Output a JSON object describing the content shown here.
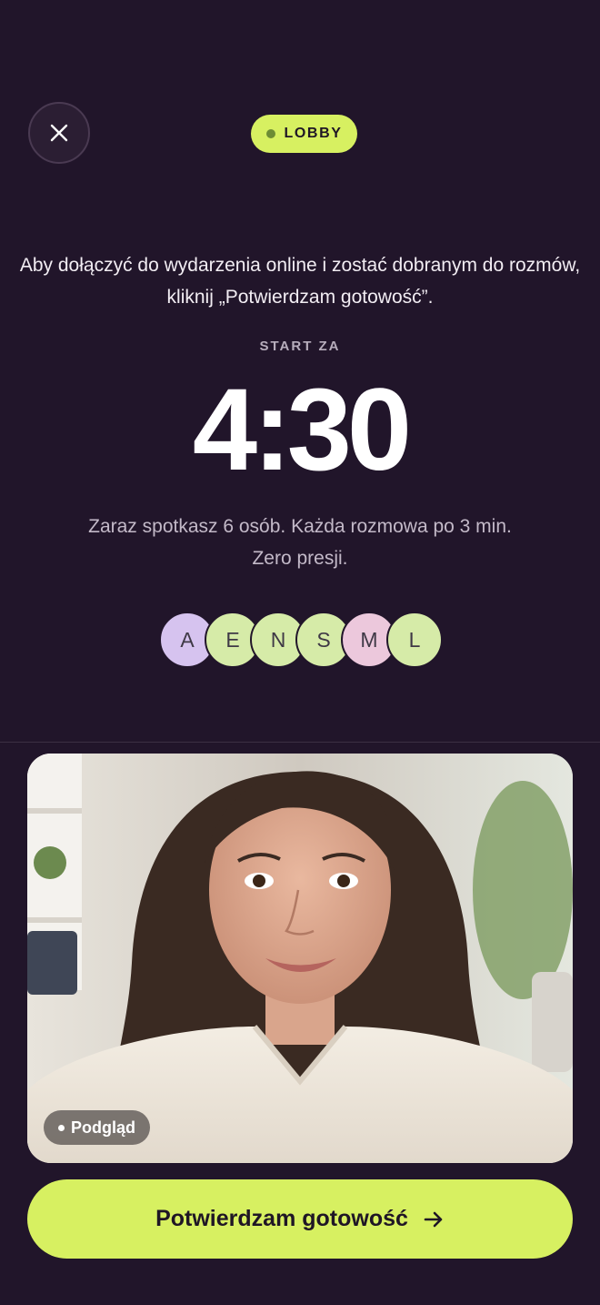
{
  "header": {
    "close_icon": "close-icon",
    "badge_label": "LOBBY",
    "badge_dot_color": "#6d8c34"
  },
  "intro": {
    "text": "Aby dołączyć do wydarzenia online i zostać dobranym do rozmów, kliknij „Potwierdzam gotowość”."
  },
  "countdown": {
    "label": "START ZA",
    "time": "4:30"
  },
  "description": {
    "text": "Zaraz spotkasz 6 osób. Każda rozmowa po 3 min. Zero presji."
  },
  "participants": [
    {
      "initial": "A",
      "color": "#d6c3ef"
    },
    {
      "initial": "E",
      "color": "#d6eba8"
    },
    {
      "initial": "N",
      "color": "#d6eba8"
    },
    {
      "initial": "S",
      "color": "#d6eba8"
    },
    {
      "initial": "M",
      "color": "#ecc8dc"
    },
    {
      "initial": "L",
      "color": "#d6eba8"
    }
  ],
  "preview": {
    "badge_label": "Podgląd"
  },
  "cta": {
    "label": "Potwierdzam gotowość",
    "icon": "arrow-right-icon"
  },
  "colors": {
    "background": "#21152a",
    "accent": "#d7f061"
  }
}
